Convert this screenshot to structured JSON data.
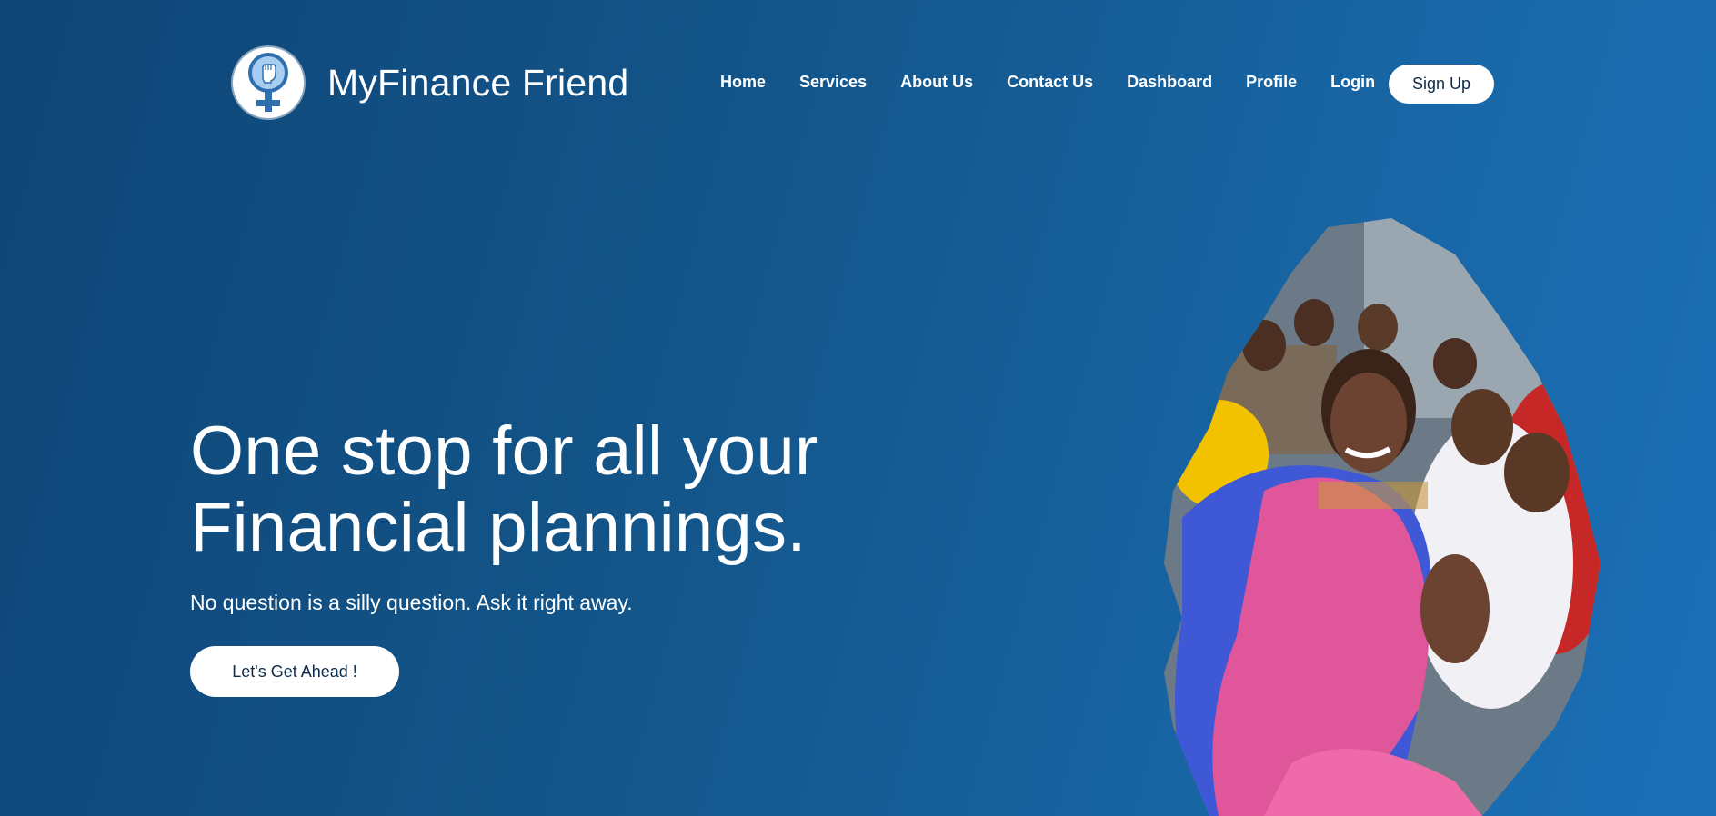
{
  "brand": {
    "name": "MyFinance Friend",
    "logo_icon": "female-symbol-fist-icon"
  },
  "nav": {
    "links": [
      "Home",
      "Services",
      "About Us",
      "Contact Us",
      "Dashboard",
      "Profile",
      "Login"
    ],
    "signup_label": "Sign Up"
  },
  "hero": {
    "title_line1": "One stop for all your",
    "title_line2": "Financial plannings.",
    "subtitle": "No question is a silly question. Ask it right away.",
    "cta_label": "Let's Get Ahead !",
    "image_alt": "Group of smiling women in colorful saris"
  },
  "colors": {
    "background_start": "#0f4577",
    "background_end": "#1c70b8",
    "button_bg": "#ffffff",
    "button_text": "#0f2b4a",
    "logo_blue": "#2f6fb0",
    "logo_light": "#a9cdf0"
  }
}
